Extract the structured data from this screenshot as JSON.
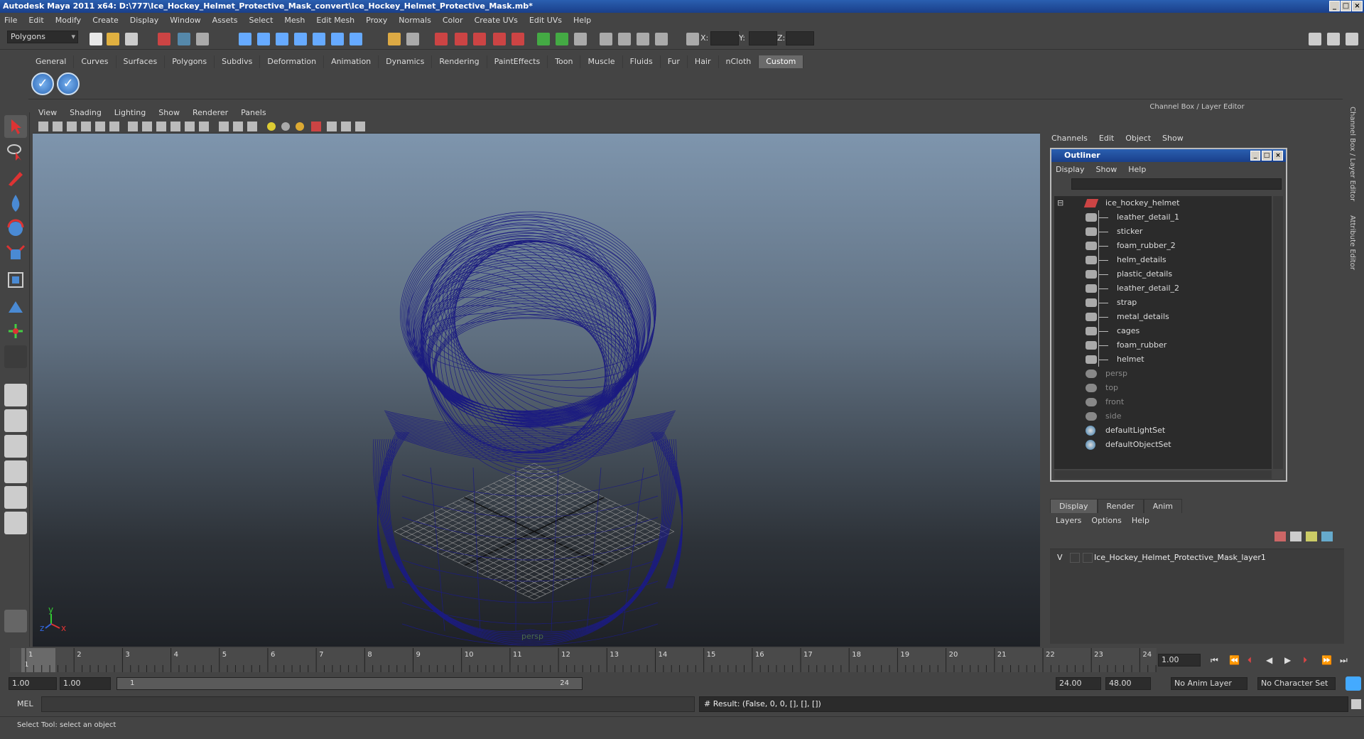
{
  "title": "Autodesk Maya 2011 x64: D:\\777\\Ice_Hockey_Helmet_Protective_Mask_convert\\Ice_Hockey_Helmet_Protective_Mask.mb*",
  "menu": [
    "File",
    "Edit",
    "Modify",
    "Create",
    "Display",
    "Window",
    "Assets",
    "Select",
    "Mesh",
    "Edit Mesh",
    "Proxy",
    "Normals",
    "Color",
    "Create UVs",
    "Edit UVs",
    "Help"
  ],
  "mode_select": "Polygons",
  "coords": {
    "x": "X:",
    "y": "Y:",
    "z": "Z:"
  },
  "shelf_tabs": [
    "General",
    "Curves",
    "Surfaces",
    "Polygons",
    "Subdivs",
    "Deformation",
    "Animation",
    "Dynamics",
    "Rendering",
    "PaintEffects",
    "Toon",
    "Muscle",
    "Fluids",
    "Fur",
    "Hair",
    "nCloth",
    "Custom"
  ],
  "shelf_active": "Custom",
  "viewport_menu": [
    "View",
    "Shading",
    "Lighting",
    "Show",
    "Renderer",
    "Panels"
  ],
  "viewport_camera": "persp",
  "axis": {
    "y": "y",
    "x": "x",
    "z": "z"
  },
  "right_panel": {
    "header": "Channel Box / Layer Editor",
    "menu": [
      "Channels",
      "Edit",
      "Object",
      "Show"
    ],
    "side_tabs": [
      "Channel Box / Layer Editor",
      "Attribute Editor"
    ]
  },
  "outliner": {
    "title": "Outliner",
    "menu": [
      "Display",
      "Show",
      "Help"
    ],
    "root": "ice_hockey_helmet",
    "children": [
      "leather_detail_1",
      "sticker",
      "foam_rubber_2",
      "helm_details",
      "plastic_details",
      "leather_detail_2",
      "strap",
      "metal_details",
      "cages",
      "foam_rubber",
      "helmet"
    ],
    "cameras": [
      "persp",
      "top",
      "front",
      "side"
    ],
    "sets": [
      "defaultLightSet",
      "defaultObjectSet"
    ]
  },
  "layer_editor": {
    "tabs": [
      "Display",
      "Render",
      "Anim"
    ],
    "active_tab": "Display",
    "menu": [
      "Layers",
      "Options",
      "Help"
    ],
    "layer_visible": "V",
    "layer_name": "Ice_Hockey_Helmet_Protective_Mask_layer1"
  },
  "timeline": {
    "ticks": [
      "1",
      "2",
      "3",
      "4",
      "5",
      "6",
      "7",
      "8",
      "9",
      "10",
      "11",
      "12",
      "13",
      "14",
      "15",
      "16",
      "17",
      "18",
      "19",
      "20",
      "21",
      "22",
      "23",
      "24"
    ],
    "current_marker": "1",
    "current_frame": "1.00"
  },
  "range": {
    "start": "1.00",
    "playback_start": "1.00",
    "slider_start": "1",
    "slider_end": "24",
    "playback_end": "24.00",
    "end": "48.00",
    "anim_layer": "No Anim Layer",
    "character_set": "No Character Set"
  },
  "command": {
    "mel_label": "MEL",
    "result": "# Result: (False, 0, 0, [], [], [])"
  },
  "help_line": "Select Tool: select an object",
  "colors": {
    "wire": "#1a1a7a",
    "grid": "#aaaaaa",
    "title": "#1a3f8a"
  }
}
